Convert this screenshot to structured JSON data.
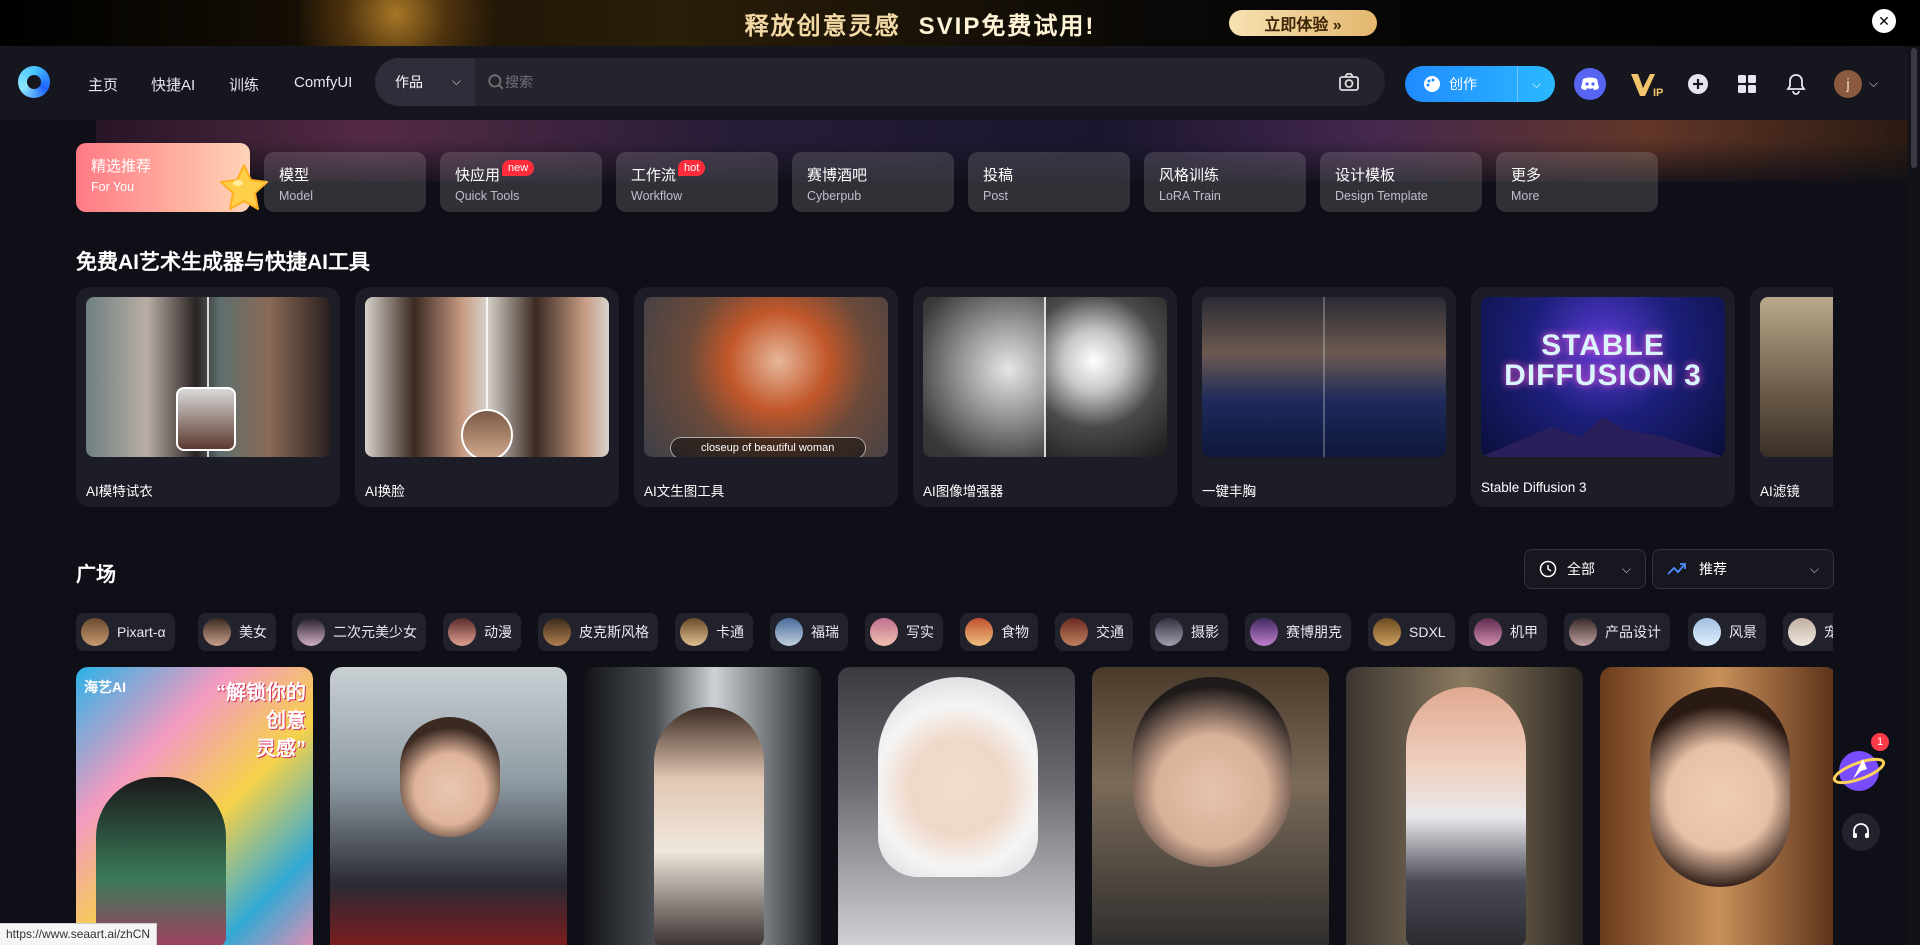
{
  "promo": {
    "text": "释放创意灵感",
    "highlight": "SVIP免费试用!",
    "button": "立即体验 »",
    "close": "✕"
  },
  "nav": {
    "items": [
      "主页",
      "快捷AI",
      "训练",
      "ComfyUI"
    ]
  },
  "search": {
    "type": "作品",
    "placeholder": "搜索"
  },
  "header": {
    "create_label": "创作",
    "avatar_letter": "j"
  },
  "categories": [
    {
      "zh": "精选推荐",
      "en": "For You"
    },
    {
      "zh": "模型",
      "en": "Model"
    },
    {
      "zh": "快应用",
      "en": "Quick Tools",
      "badge": "new"
    },
    {
      "zh": "工作流",
      "en": "Workflow",
      "badge": "hot"
    },
    {
      "zh": "赛博酒吧",
      "en": "Cyberpub"
    },
    {
      "zh": "投稿",
      "en": "Post"
    },
    {
      "zh": "风格训练",
      "en": "LoRA Train"
    },
    {
      "zh": "设计模板",
      "en": "Design Template"
    },
    {
      "zh": "更多",
      "en": "More"
    }
  ],
  "tools_section": {
    "title": "免费AI艺术生成器与快捷AI工具",
    "items": [
      "AI模特试衣",
      "AI换脸",
      "AI文生图工具",
      "AI图像增强器",
      "一键丰胸",
      "Stable Diffusion 3",
      "AI滤镜"
    ],
    "caption_overlay": "closeup of beautiful woman",
    "sd3_logo": "STABLE DIFFUSION 3"
  },
  "square": {
    "title": "广场",
    "filter_time": "全部",
    "filter_sort": "推荐",
    "tags": [
      "Pixart-α",
      "美女",
      "二次元美少女",
      "动漫",
      "皮克斯风格",
      "卡通",
      "福瑞",
      "写实",
      "食物",
      "交通",
      "摄影",
      "赛博朋克",
      "SDXL",
      "机甲",
      "产品设计",
      "风景",
      "宠物"
    ]
  },
  "gallery": {
    "first_card_logo": "海艺AI",
    "first_card_slogan": [
      "“解锁你的",
      "创意",
      "灵感”"
    ]
  },
  "float": {
    "notification_count": "1"
  },
  "status_url": "https://www.seaart.ai/zhCN",
  "colors": {
    "accent": "#1f8bff",
    "badge": "#ff2d3b",
    "bg": "#0f0f17"
  }
}
